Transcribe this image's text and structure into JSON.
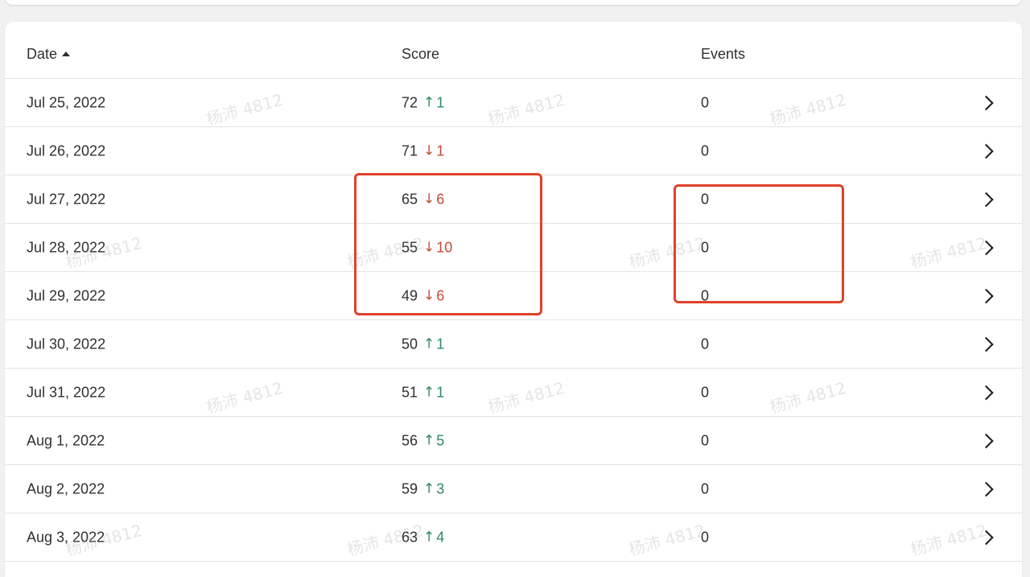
{
  "table": {
    "headers": {
      "date": "Date",
      "score": "Score",
      "events": "Events"
    },
    "rows": [
      {
        "date": "Jul 25, 2022",
        "score": "72",
        "delta": "1",
        "direction": "up",
        "events": "0"
      },
      {
        "date": "Jul 26, 2022",
        "score": "71",
        "delta": "1",
        "direction": "down",
        "events": "0"
      },
      {
        "date": "Jul 27, 2022",
        "score": "65",
        "delta": "6",
        "direction": "down",
        "events": "0"
      },
      {
        "date": "Jul 28, 2022",
        "score": "55",
        "delta": "10",
        "direction": "down",
        "events": "0"
      },
      {
        "date": "Jul 29, 2022",
        "score": "49",
        "delta": "6",
        "direction": "down",
        "events": "0"
      },
      {
        "date": "Jul 30, 2022",
        "score": "50",
        "delta": "1",
        "direction": "up",
        "events": "0"
      },
      {
        "date": "Jul 31, 2022",
        "score": "51",
        "delta": "1",
        "direction": "up",
        "events": "0"
      },
      {
        "date": "Aug 1, 2022",
        "score": "56",
        "delta": "5",
        "direction": "up",
        "events": "0"
      },
      {
        "date": "Aug 2, 2022",
        "score": "59",
        "delta": "3",
        "direction": "up",
        "events": "0"
      },
      {
        "date": "Aug 3, 2022",
        "score": "63",
        "delta": "4",
        "direction": "up",
        "events": "0"
      }
    ]
  },
  "arrows": {
    "up": "↑",
    "down": "↓"
  },
  "icons": {
    "sort": "sort-ascending-icon",
    "row_action": "chevron-right-icon"
  },
  "colors": {
    "up": "#2e8b5f",
    "down": "#c94a35",
    "highlight": "#e0412a"
  },
  "watermark": "杨沛 4812"
}
